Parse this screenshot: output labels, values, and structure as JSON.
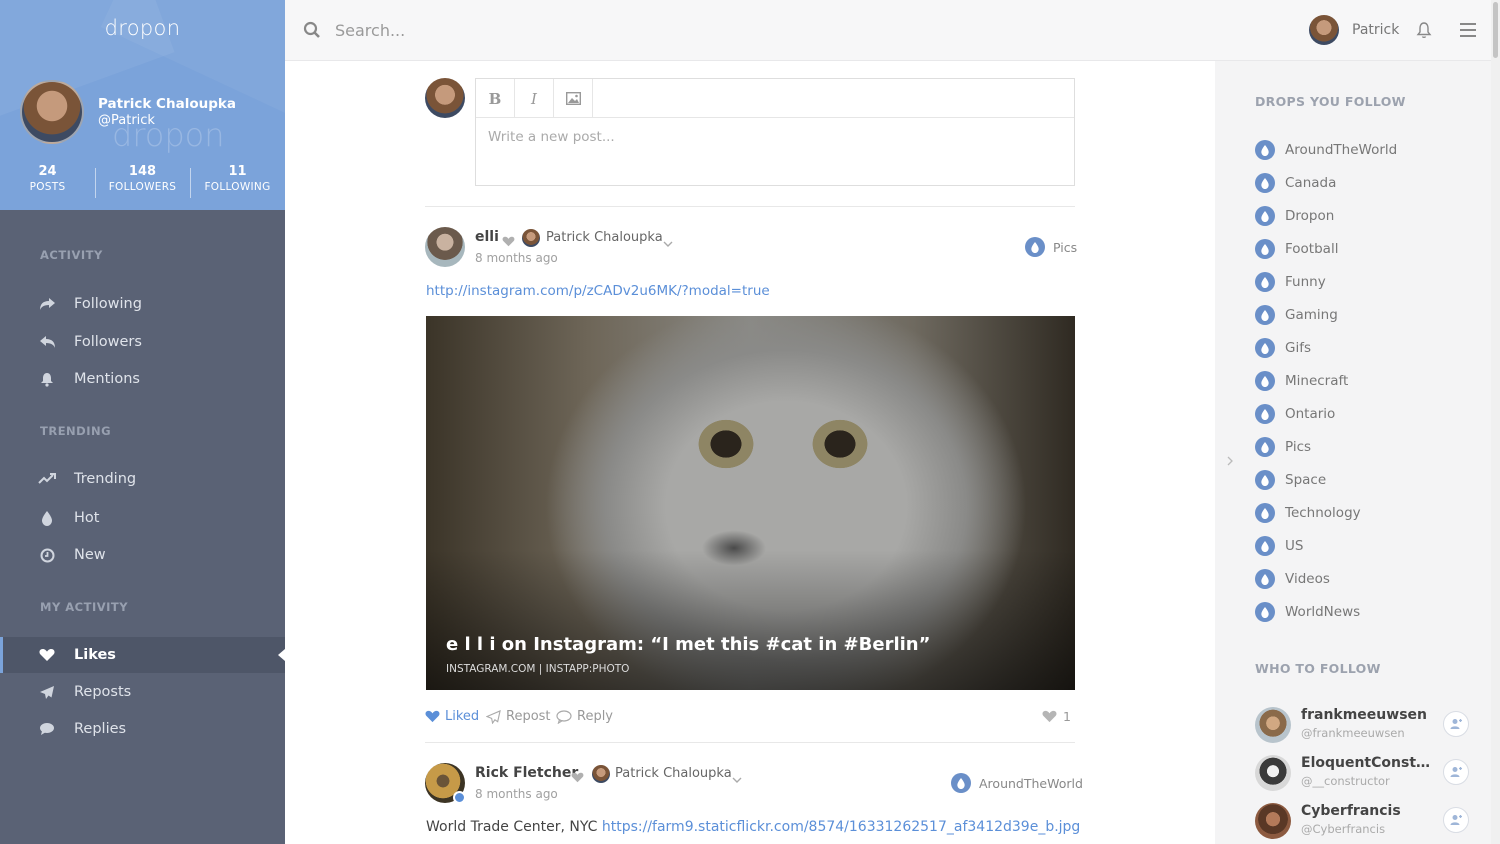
{
  "brand": "dropon",
  "profile": {
    "name": "Patrick Chaloupka",
    "handle": "@Patrick",
    "stats": [
      {
        "value": "24",
        "label": "POSTS"
      },
      {
        "value": "148",
        "label": "FOLLOWERS"
      },
      {
        "value": "11",
        "label": "FOLLOWING"
      }
    ]
  },
  "nav": {
    "sections": [
      "ACTIVITY",
      "TRENDING",
      "MY ACTIVITY"
    ],
    "activity": [
      {
        "label": "Following",
        "icon": "share-arrow-icon"
      },
      {
        "label": "Followers",
        "icon": "reply-arrow-icon"
      },
      {
        "label": "Mentions",
        "icon": "bell-icon"
      }
    ],
    "trending": [
      {
        "label": "Trending",
        "icon": "trend-line-icon"
      },
      {
        "label": "Hot",
        "icon": "drop-icon"
      },
      {
        "label": "New",
        "icon": "clock-icon"
      }
    ],
    "my_activity": [
      {
        "label": "Likes",
        "icon": "heart-icon",
        "active": true
      },
      {
        "label": "Reposts",
        "icon": "paper-plane-icon"
      },
      {
        "label": "Replies",
        "icon": "speech-bubble-icon"
      }
    ]
  },
  "topbar": {
    "search_placeholder": "Search...",
    "user_name": "Patrick"
  },
  "composer": {
    "placeholder": "Write a new post...",
    "bold": "B",
    "italic": "I"
  },
  "posts": [
    {
      "author": "elli",
      "liked_by": "Patrick Chaloupka",
      "time": "8 months ago",
      "drop": "Pics",
      "link": "http://instagram.com/p/zCADv2u6MK/?modal=true",
      "embed_title": "e l l i on Instagram: “I met this #cat in #Berlin”",
      "embed_meta": "INSTAGRAM.COM | INSTAPP:PHOTO",
      "actions": {
        "liked": "Liked",
        "repost": "Repost",
        "reply": "Reply"
      },
      "like_count": "1"
    },
    {
      "author": "Rick Fletcher",
      "liked_by": "Patrick Chaloupka",
      "time": "8 months ago",
      "drop": "AroundTheWorld",
      "text": "World Trade Center, NYC",
      "link": "https://farm9.staticflickr.com/8574/16331262517_af3412d39e_b.jpg"
    }
  ],
  "right": {
    "drops_heading": "DROPS YOU FOLLOW",
    "drops": [
      "AroundTheWorld",
      "Canada",
      "Dropon",
      "Football",
      "Funny",
      "Gaming",
      "Gifs",
      "Minecraft",
      "Ontario",
      "Pics",
      "Space",
      "Technology",
      "US",
      "Videos",
      "WorldNews"
    ],
    "who_heading": "WHO TO FOLLOW",
    "who": [
      {
        "name": "frankmeeuwsen",
        "handle": "@frankmeeuwsen"
      },
      {
        "name": "EloquentConstructor",
        "handle": "@__constructor"
      },
      {
        "name": "Cyberfrancis",
        "handle": "@Cyberfrancis"
      }
    ]
  },
  "colors": {
    "accent": "#7ba3da",
    "sidebar": "#5a6275",
    "link": "#5b8fd8"
  }
}
